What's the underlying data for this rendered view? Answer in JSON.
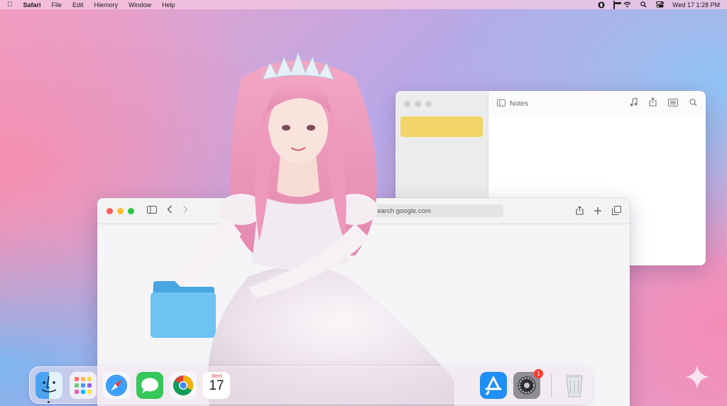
{
  "menubar": {
    "app_name": "Safari",
    "menus": [
      "File",
      "Edit",
      "Hiemory",
      "Window",
      "Help"
    ],
    "clock": "Wed 17 1:28 PM"
  },
  "notes_window": {
    "title": "Notes",
    "note_card_color": "#f2d568"
  },
  "safari_window": {
    "search_placeholder": "Search google.com"
  },
  "dock": {
    "apps": [
      {
        "name": "Finder",
        "icon": "finder-icon"
      },
      {
        "name": "Launchpad",
        "icon": "launchpad-icon"
      },
      {
        "name": "Safari",
        "icon": "safari-icon"
      },
      {
        "name": "Messages",
        "icon": "messages-icon"
      },
      {
        "name": "Chrome",
        "icon": "chrome-icon"
      },
      {
        "name": "Calendar",
        "icon": "calendar-icon",
        "weekday": "Wed",
        "day": "17"
      },
      {
        "name": "App Store",
        "icon": "app-store-icon"
      },
      {
        "name": "System Settings",
        "icon": "settings-icon",
        "badge": "1"
      },
      {
        "name": "Trash",
        "icon": "trash-icon"
      }
    ]
  },
  "colors": {
    "close": "#ff5f57",
    "minimize": "#febc2e",
    "zoom": "#28c840",
    "folder": "#6ec3f2"
  }
}
